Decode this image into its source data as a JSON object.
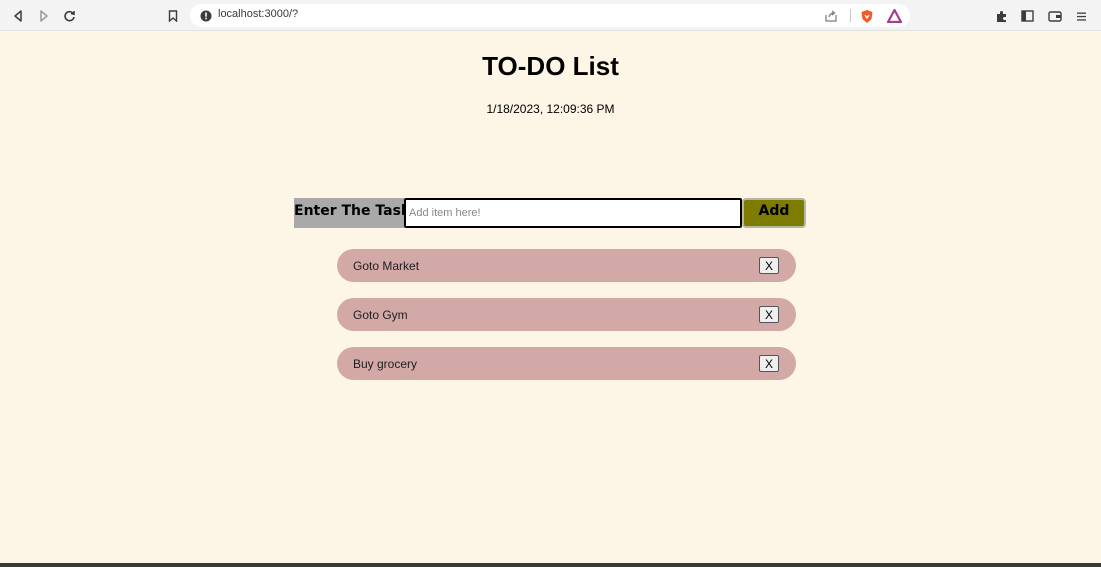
{
  "browser": {
    "url": "localhost:3000/?"
  },
  "app": {
    "title": "TO-DO List",
    "datetime": "1/18/2023, 12:09:36 PM",
    "task_label": "Enter The Task",
    "input_placeholder": "Add item here!",
    "input_value": "",
    "add_label": "Add",
    "items": [
      {
        "text": "Goto Market",
        "delete_label": "X"
      },
      {
        "text": "Goto Gym",
        "delete_label": "X"
      },
      {
        "text": "Buy grocery",
        "delete_label": "X"
      }
    ]
  },
  "colors": {
    "page_background": "#fdf6e6",
    "item_background": "#d3a9a8",
    "add_button": "#7d7b00",
    "label_background": "#a9a9a9"
  },
  "icons": [
    "back-icon",
    "forward-icon",
    "reload-icon",
    "bookmark-icon",
    "site-info-icon",
    "share-icon",
    "brave-shield-icon",
    "brave-rewards-icon",
    "extensions-icon",
    "sidebar-icon",
    "wallet-icon",
    "menu-icon"
  ]
}
